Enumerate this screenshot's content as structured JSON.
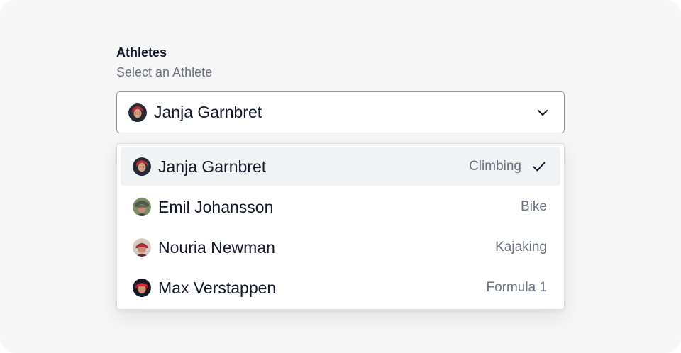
{
  "field": {
    "label": "Athletes",
    "description": "Select an Athlete"
  },
  "select": {
    "value": "Janja Garnbret",
    "avatar_icon": "avatar-janja-icon",
    "toggle_icon": "chevron-down-icon"
  },
  "options": [
    {
      "name": "Janja Garnbret",
      "sport": "Climbing",
      "selected": true,
      "avatar_icon": "avatar-janja-icon"
    },
    {
      "name": "Emil Johansson",
      "sport": "Bike",
      "selected": false,
      "avatar_icon": "avatar-emil-icon"
    },
    {
      "name": "Nouria Newman",
      "sport": "Kajaking",
      "selected": false,
      "avatar_icon": "avatar-nouria-icon"
    },
    {
      "name": "Max Verstappen",
      "sport": "Formula 1",
      "selected": false,
      "avatar_icon": "avatar-max-icon"
    }
  ],
  "selected_indicator_icon": "check-icon",
  "colors": {
    "background": "#f7f7f7",
    "text": "#111827",
    "muted_text": "#6b7280",
    "border": "#8a8f98",
    "selected_option": "#f1f2f4"
  }
}
